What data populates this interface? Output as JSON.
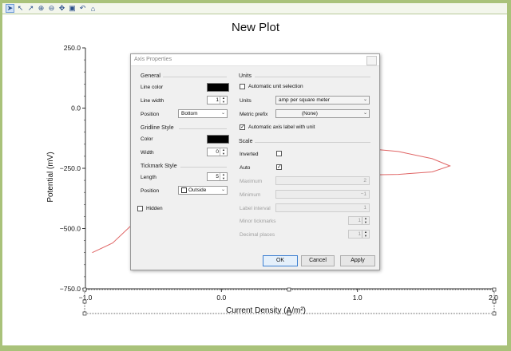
{
  "toolbar": {
    "icons": [
      "pointer-icon",
      "arrow-icon",
      "arrow-small-icon",
      "zoom-in-icon",
      "zoom-out-icon",
      "pan-icon",
      "zoom-box-icon",
      "undo-icon",
      "home-icon"
    ]
  },
  "plot": {
    "title": "New Plot",
    "xlabel": "Current Density (A/m²)",
    "ylabel": "Potential (mV)",
    "yticks": [
      "250.0",
      "0.0",
      "−250.0",
      "−500.0",
      "−750.0"
    ],
    "xticks": [
      "−1.0",
      "0.0",
      "1.0",
      "2.0"
    ]
  },
  "chart_data": {
    "type": "line",
    "xlabel": "Current Density (A/m²)",
    "ylabel": "Potential (mV)",
    "xlim": [
      -1.0,
      2.0
    ],
    "ylim": [
      -750.0,
      250.0
    ],
    "series": [
      {
        "color": "#e06666",
        "x": [
          -0.95,
          -0.8,
          -0.65,
          -0.55,
          -0.45,
          0.6,
          1.0,
          1.3,
          1.55,
          1.68,
          1.55,
          1.3,
          1.0,
          0.6
        ],
        "y": [
          -600,
          -560,
          -480,
          -410,
          -330,
          -160,
          -165,
          -180,
          -210,
          -240,
          -265,
          -275,
          -278,
          -282
        ]
      }
    ]
  },
  "dialog": {
    "title": "Axis Properties",
    "general": {
      "header": "General",
      "line_color_label": "Line color",
      "line_width_label": "Line width",
      "line_width_value": "1",
      "position_label": "Position",
      "position_value": "Bottom"
    },
    "gridline": {
      "header": "Gridline Style",
      "color_label": "Color",
      "width_label": "Width",
      "width_value": "0"
    },
    "tickmark": {
      "header": "Tickmark Style",
      "length_label": "Length",
      "length_value": "5",
      "position_label": "Position",
      "position_value": "Outside"
    },
    "hidden_label": "Hidden",
    "units": {
      "header": "Units",
      "auto_unit_label": "Automatic unit selection",
      "units_label": "Units",
      "units_value": "amp per square meter",
      "metric_prefix_label": "Metric prefix",
      "metric_prefix_value": "(None)",
      "auto_axis_label": "Automatic axis label with unit"
    },
    "scale": {
      "header": "Scale",
      "inverted_label": "Inverted",
      "auto_label": "Auto",
      "maximum_label": "Maximum",
      "maximum_value": "2",
      "minimum_label": "Minimum",
      "minimum_value": "−1",
      "label_interval_label": "Label interval",
      "label_interval_value": "1",
      "minor_tickmarks_label": "Minor tickmarks",
      "minor_tickmarks_value": "1",
      "decimal_places_label": "Decimal places",
      "decimal_places_value": "1"
    },
    "buttons": {
      "ok": "OK",
      "cancel": "Cancel",
      "apply": "Apply"
    },
    "check_mark": "✓",
    "spin_up": "▲",
    "spin_down": "▼",
    "dropdown_arrow": "⌄"
  },
  "colors": {
    "frame": "#a9c27a",
    "curve": "#e06666",
    "ok_border": "#3c7fd1"
  }
}
